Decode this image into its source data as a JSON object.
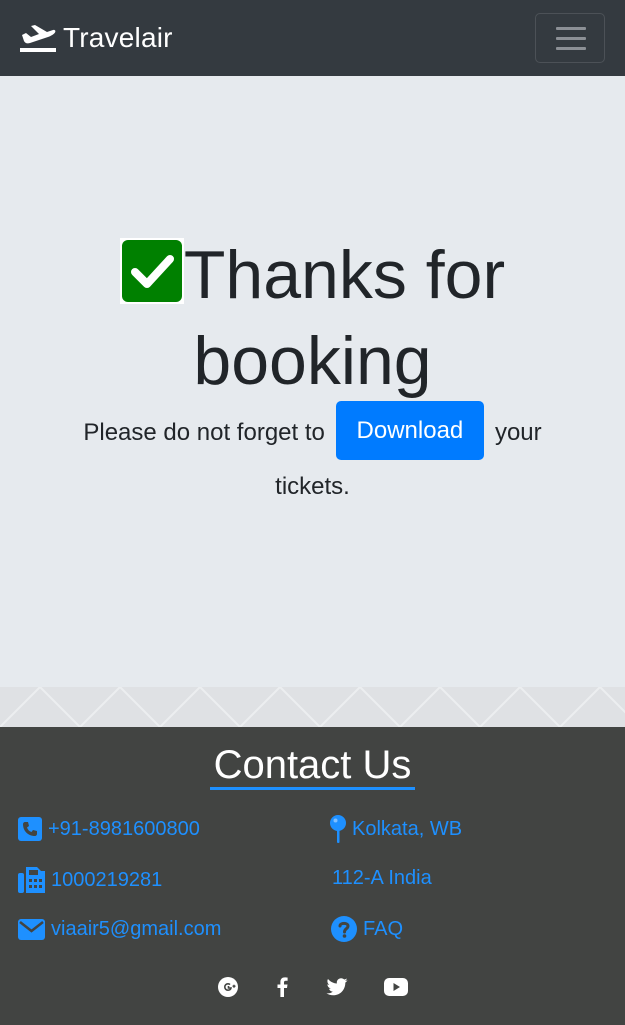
{
  "navbar": {
    "brand": "Travelair",
    "brand_icon": "plane-departure-icon",
    "menu_icon": "hamburger-menu-icon"
  },
  "hero": {
    "check_icon": "check-square-icon",
    "headline": "Thanks for booking",
    "text_before": "Please do not forget to",
    "button_label": "Download",
    "text_after_1": "your",
    "text_after_2": "tickets.",
    "accent": "#007bff",
    "check_color": "#008000"
  },
  "footer": {
    "title": "Contact Us",
    "accent": "#1e90ff",
    "contacts": {
      "phone": "+91-8981600800",
      "fax": "1000219281",
      "email": "viaair5@gmail.com",
      "city": "Kolkata, WB",
      "address": "112-A India",
      "faq": "FAQ"
    },
    "social": [
      "google-plus-icon",
      "facebook-icon",
      "twitter-icon",
      "youtube-icon"
    ]
  }
}
